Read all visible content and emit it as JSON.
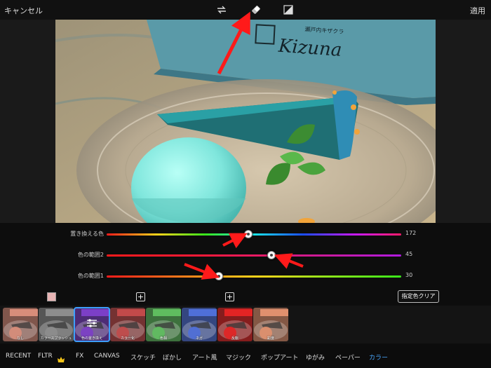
{
  "topbar": {
    "cancel_label": "キャンセル",
    "apply_label": "適用",
    "icons": [
      "swap-icon",
      "eraser-icon",
      "compare-icon"
    ]
  },
  "photo": {
    "box_brand": "Kizuna",
    "box_subtitle": "瀬戸内キザクラ"
  },
  "sliders": [
    {
      "label": "置き換える色",
      "value": "172",
      "fraction": 0.48
    },
    {
      "label": "色の範囲2",
      "value": "45",
      "fraction": 0.56
    },
    {
      "label": "色の範囲1",
      "value": "30",
      "fraction": 0.38
    }
  ],
  "controls": {
    "selected_color": "#e7b4b4",
    "plus_label": "+",
    "clear_label": "指定色クリア"
  },
  "thumbnails": [
    {
      "label": "なし",
      "tint": "#d88d7a"
    },
    {
      "label": "カラースプラッシュ",
      "tint": "#8d8d8d"
    },
    {
      "label": "色の置き換え",
      "tint": "#7c3fc7",
      "selected": true
    },
    {
      "label": "カラー化",
      "tint": "#c24a4a"
    },
    {
      "label": "色相",
      "tint": "#5fbd5f"
    },
    {
      "label": "ネガ",
      "tint": "#4f6fd8"
    },
    {
      "label": "反転",
      "tint": "#e32424"
    },
    {
      "label": "彩度",
      "tint": "#e0906e"
    }
  ],
  "categories": [
    "RECENT",
    "FLTR",
    "FX",
    "CANVAS",
    "スケッチ",
    "ぼかし",
    "アート風",
    "マジック",
    "ポップアート",
    "ゆがみ",
    "ペーパー",
    "カラー"
  ],
  "active_category": "カラー",
  "crown_icon": "crown-icon",
  "colors": {
    "accent": "#3ea0ff",
    "arrow": "#ff1a1a",
    "panel": "#0d0d0d"
  }
}
